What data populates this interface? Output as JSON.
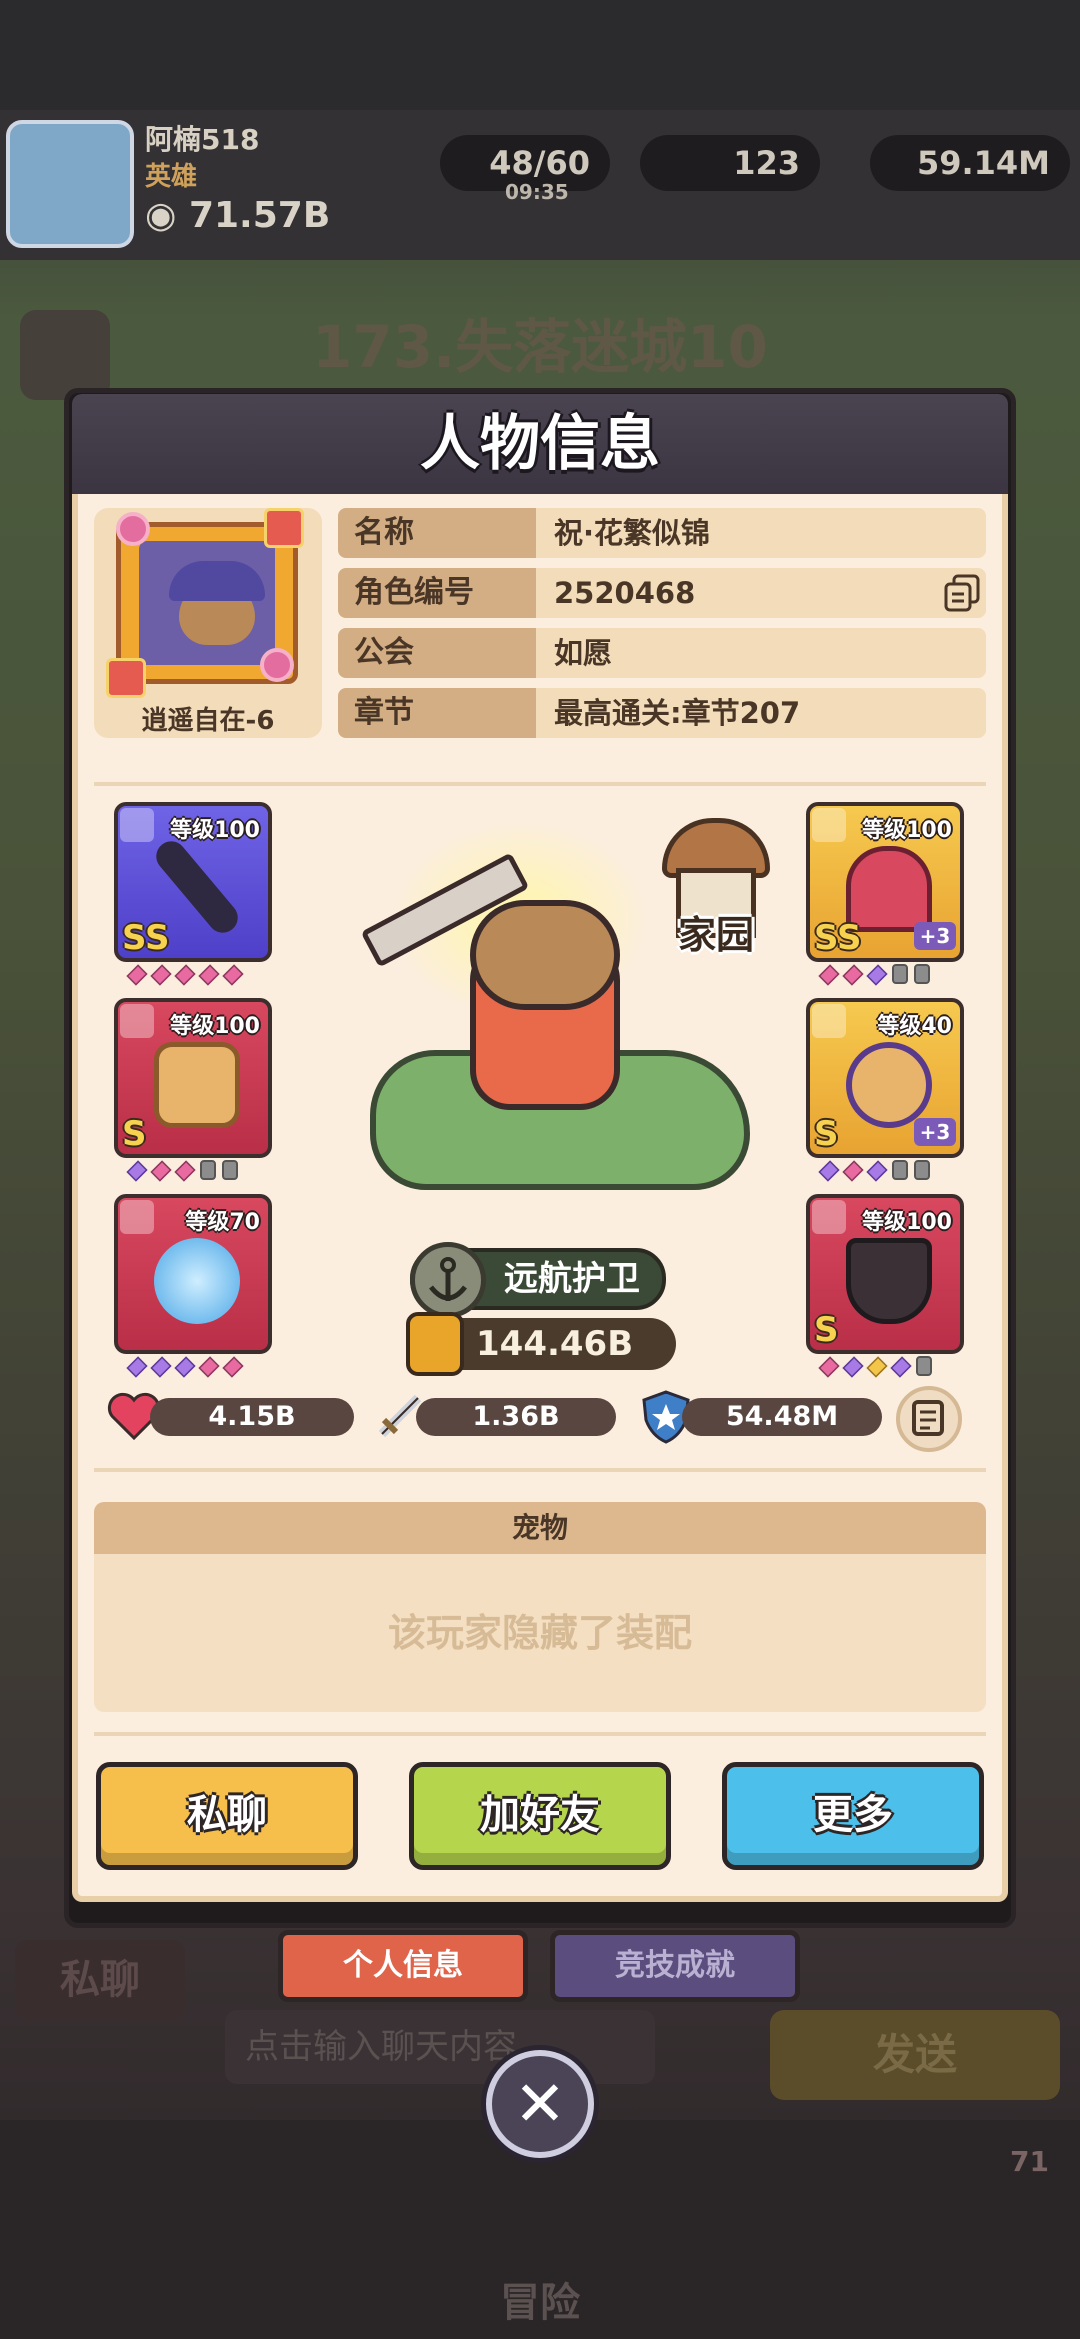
{
  "background": {
    "player_name": "阿楠518",
    "player_title": "英雄",
    "player_power": "71.57B",
    "energy": "48/60",
    "energy_timer": "09:35",
    "gems": "123",
    "gold": "59.14M",
    "stage_title": "173.失落迷城10",
    "chat_placeholder": "点击输入聊天内容",
    "send_label": "发送",
    "private_chat_bg": "私聊",
    "adventure_label": "冒险",
    "badge_count": "71"
  },
  "dialog": {
    "title": "人物信息",
    "portrait_label": "逍遥自在-6",
    "info": [
      {
        "key": "名称",
        "value": "祝·花繁似锦"
      },
      {
        "key": "角色编号",
        "value": "2520468"
      },
      {
        "key": "公会",
        "value": "如愿"
      },
      {
        "key": "章节",
        "value": "最高通关:章节207"
      }
    ],
    "equipment_left": [
      {
        "level": "等级100",
        "rank": "SS",
        "plus": ""
      },
      {
        "level": "等级100",
        "rank": "S",
        "plus": ""
      },
      {
        "level": "等级70",
        "rank": "",
        "plus": ""
      }
    ],
    "equipment_right": [
      {
        "level": "等级100",
        "rank": "SS",
        "plus": "+3"
      },
      {
        "level": "等级40",
        "rank": "S",
        "plus": "+3"
      },
      {
        "level": "等级100",
        "rank": "S",
        "plus": ""
      }
    ],
    "home_label": "家园",
    "class_label": "远航护卫",
    "power": "144.46B",
    "stats": {
      "hp": "4.15B",
      "atk": "1.36B",
      "def": "54.48M"
    },
    "pet_header": "宠物",
    "pet_hidden": "该玩家隐藏了装配",
    "buttons": {
      "chat": "私聊",
      "add_friend": "加好友",
      "more": "更多"
    },
    "tabs": {
      "profile": "个人信息",
      "arena": "竞技成就"
    }
  },
  "colors": {
    "chat_btn": "#f6bf4b",
    "friend_btn": "#b5d64c",
    "more_btn": "#4cc0ea",
    "tab_active": "#e0644a",
    "tab_inactive": "#5b4e7e"
  }
}
